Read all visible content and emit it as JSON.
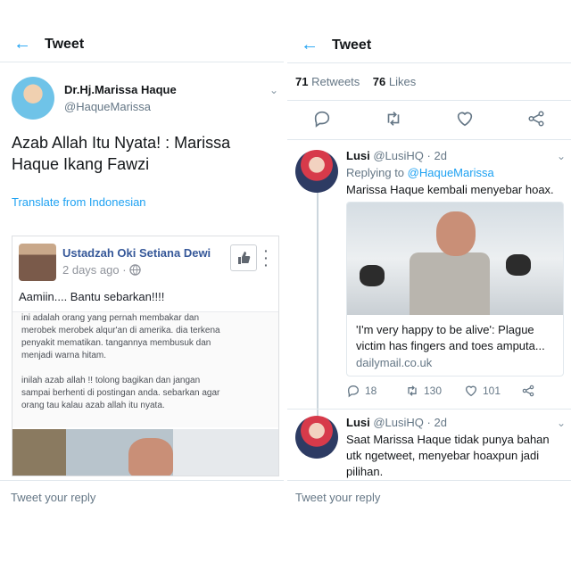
{
  "left": {
    "header": {
      "back_icon": "arrow-left-icon",
      "title": "Tweet"
    },
    "tweet": {
      "author_name": "Dr.Hj.Marissa Haque",
      "author_handle": "@HaqueMarissa",
      "text": "Azab Allah Itu Nyata! : Marissa Haque Ikang Fawzi",
      "translate_label": "Translate from Indonesian"
    },
    "embedded_post": {
      "author": "Ustadzah Oki Setiana Dewi",
      "time": "2 days ago",
      "globe_icon": "globe-icon",
      "text": "Aamiin.... Bantu sebarkan!!!!",
      "screenshot_lines": [
        "ini adalah orang yang pernah membakar dan",
        "merobek merobek alqur'an di amerika. dia terkena",
        "penyakit mematikan. tangannya membusuk dan",
        "menjadi warna hitam.",
        "",
        "inilah azab allah !! tolong bagikan dan jangan",
        "sampai berhenti di postingan anda. sebarkan agar",
        "orang tau kalau azab allah itu nyata."
      ]
    },
    "reply_placeholder": "Tweet your reply"
  },
  "right": {
    "header": {
      "back_icon": "arrow-left-icon",
      "title": "Tweet"
    },
    "stats": {
      "retweets": "71",
      "retweets_label": "Retweets",
      "likes": "76",
      "likes_label": "Likes"
    },
    "reply1": {
      "name": "Lusi",
      "handle": "@LusiHQ",
      "time": "· 2d",
      "replying_prefix": "Replying to",
      "replying_handle": "@HaqueMarissa",
      "text": "Marissa Haque kembali menyebar hoax.",
      "link_title": "'I'm very happy to be alive': Plague victim has fingers and toes amputa...",
      "link_domain": "dailymail.co.uk",
      "replies": "18",
      "retweets": "130",
      "likes": "101"
    },
    "reply2": {
      "name": "Lusi",
      "handle": "@LusiHQ",
      "time": "· 2d",
      "text": "Saat Marissa Haque tidak punya bahan utk ngetweet, menyebar hoaxpun jadi pilihan."
    },
    "reply_placeholder": "Tweet your reply"
  },
  "colors": {
    "accent": "#1da1f2",
    "text": "#14171a",
    "muted": "#657786",
    "fb_blue": "#365899"
  }
}
